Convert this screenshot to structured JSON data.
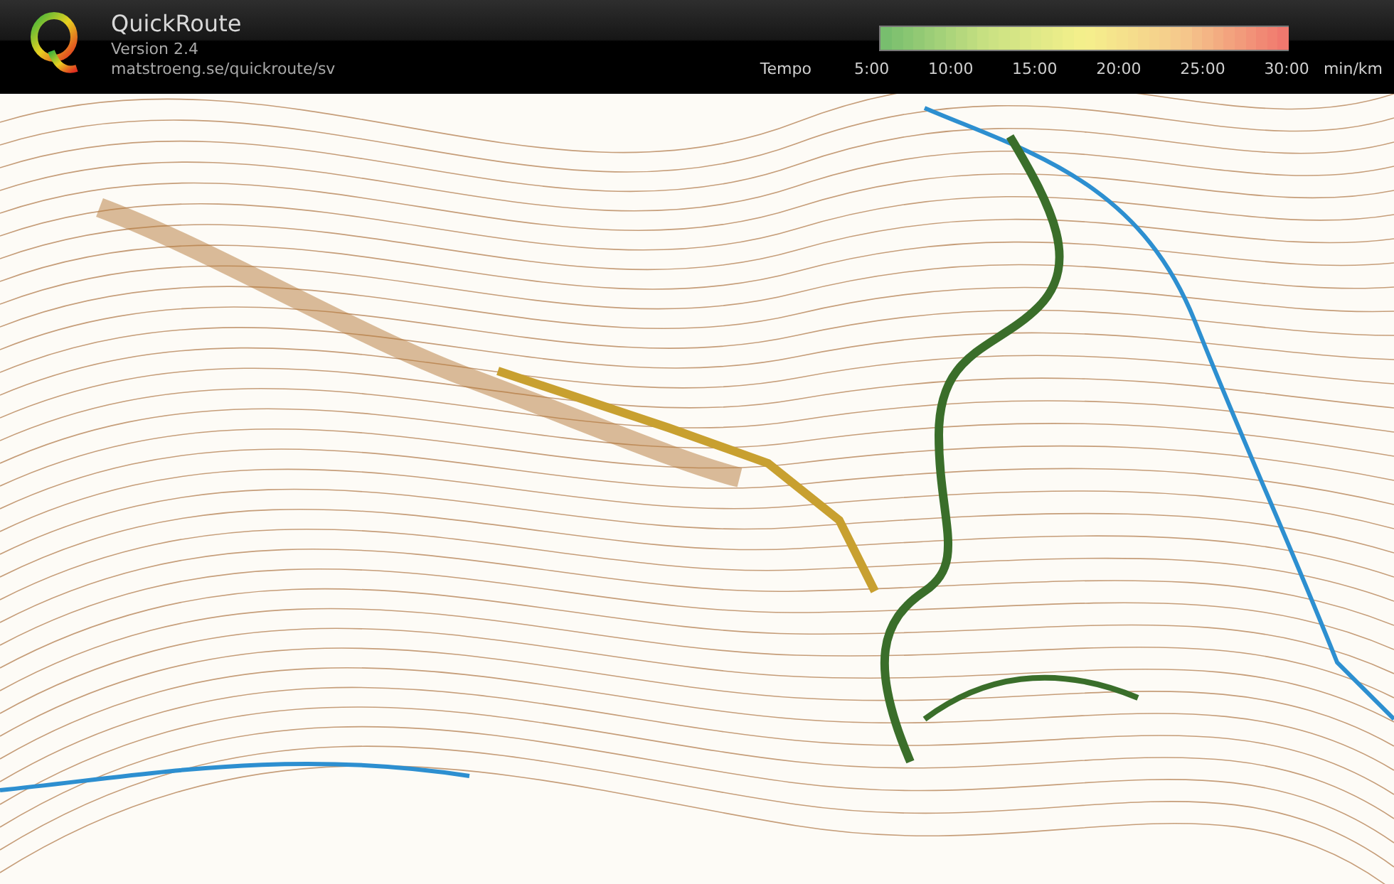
{
  "header": {
    "app_name": "QuickRoute",
    "version": "Version 2.4",
    "url": "matstroeng.se/quickroute/sv"
  },
  "legend": {
    "label": "Tempo",
    "scale_labels": [
      "5:00",
      "10:00",
      "15:00",
      "20:00",
      "25:00",
      "30:00"
    ],
    "unit": "min/km"
  }
}
